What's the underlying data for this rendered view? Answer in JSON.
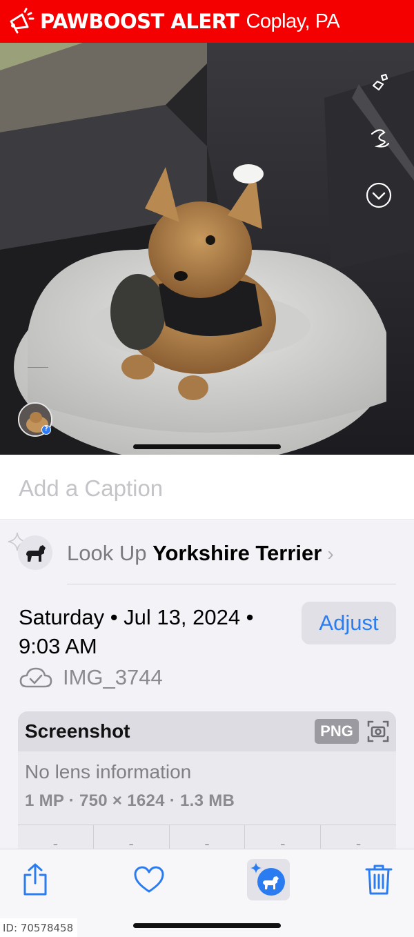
{
  "banner": {
    "brand": "PAWBOOST ALERT",
    "location": "Coplay, PA",
    "icon": "megaphone-icon",
    "color": "#f40000"
  },
  "photo": {
    "side_icons": [
      "sticker-icon",
      "scribble-icon",
      "chevron-down-circle-icon"
    ],
    "thumbnail_badge": "?"
  },
  "caption": {
    "placeholder": "Add a Caption"
  },
  "lookup": {
    "prefix": "Look Up",
    "breed": "Yorkshire Terrier",
    "chevron": "›"
  },
  "details": {
    "datetime": "Saturday • Jul 13, 2024 • 9:03 AM",
    "adjust_label": "Adjust",
    "image_name": "IMG_3744",
    "card": {
      "title": "Screenshot",
      "format_badge": "PNG",
      "lens": "No lens information",
      "specs": "1 MP · 750 × 1624 · 1.3 MB",
      "cells": [
        "-",
        "-",
        "-",
        "-",
        "-"
      ]
    }
  },
  "toolbar": {
    "icons": [
      "share-icon",
      "heart-icon",
      "visual-lookup-icon",
      "trash-icon"
    ],
    "accent": "#2b7cf0"
  },
  "id_tag": "ID: 70578458"
}
